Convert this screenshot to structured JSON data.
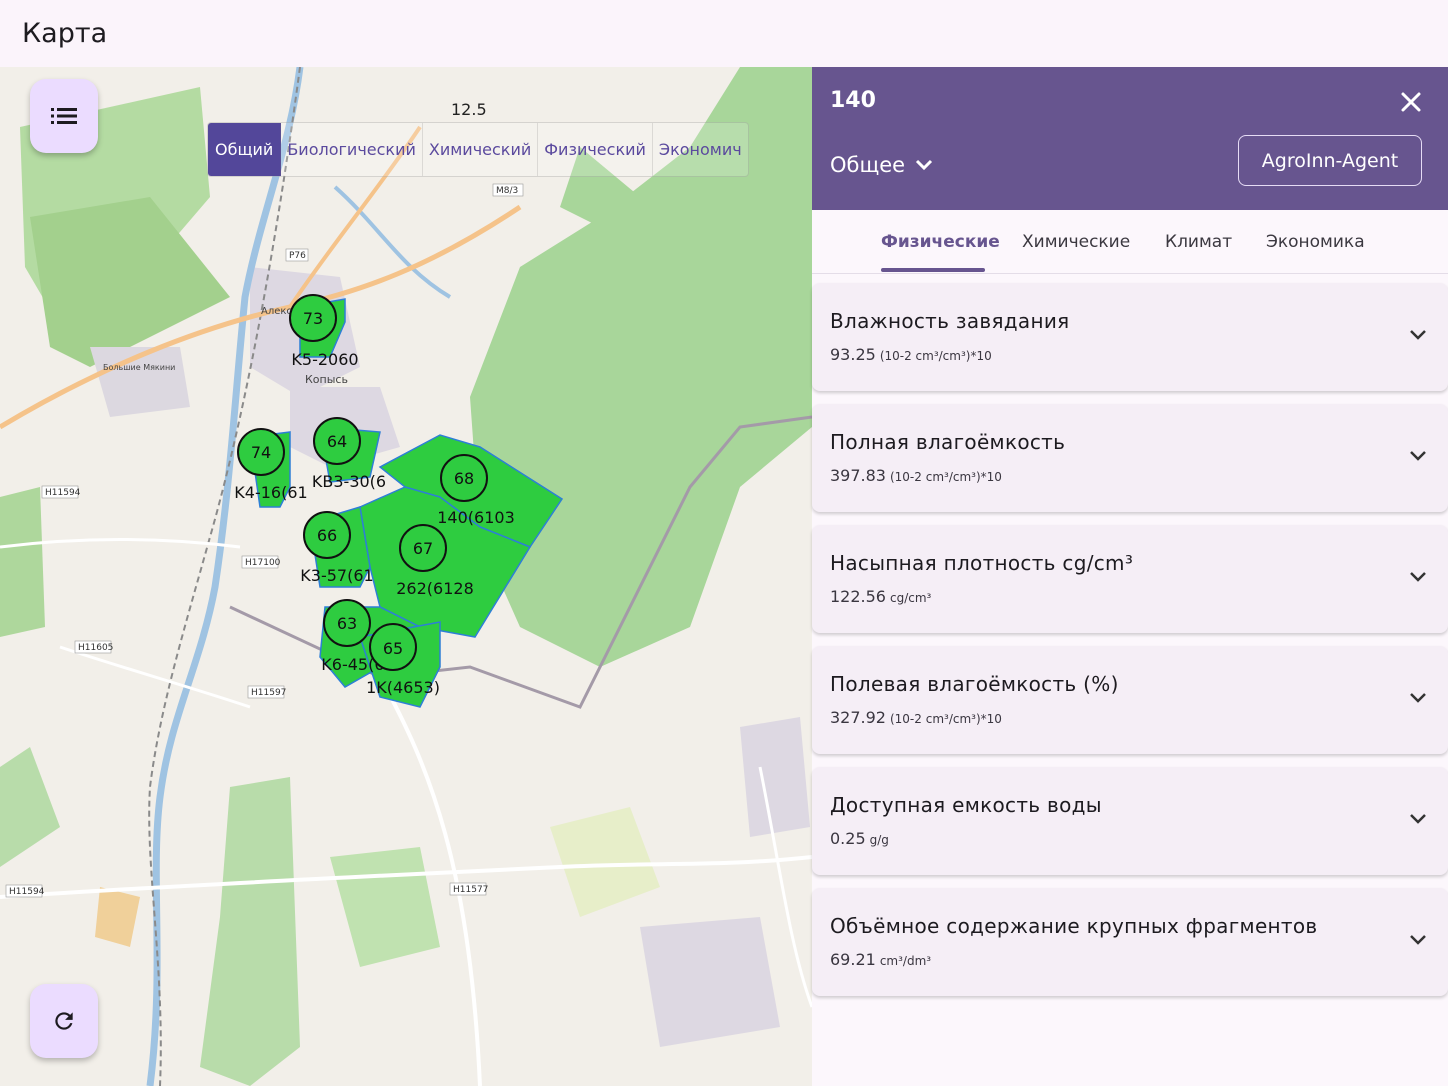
{
  "app": {
    "title": "Карта"
  },
  "map": {
    "layer_tabs": [
      "Общий",
      "Биологический",
      "Химический",
      "Физический",
      "Экономич"
    ],
    "active_layer": "Общий",
    "scale_label": "12.5",
    "places": [
      "Алекс",
      "Копысь",
      "Большие Мякини"
    ],
    "roads": [
      "P76",
      "М8/3",
      "H11594",
      "H17100",
      "H11605",
      "H11597",
      "H11577",
      "H11594"
    ],
    "clusters": [
      {
        "count": "73",
        "label": "K5-2060"
      },
      {
        "count": "74",
        "label": "K4-16(61"
      },
      {
        "count": "64",
        "label": "KB3-30(6"
      },
      {
        "count": "68",
        "label": "140(6103"
      },
      {
        "count": "66",
        "label": "K3-57(61"
      },
      {
        "count": "67",
        "label": "262(6128"
      },
      {
        "count": "63",
        "label": "K6-45(61"
      },
      {
        "count": "65",
        "label": "1K(4653)"
      }
    ],
    "menu_icon": "list-icon",
    "refresh_icon": "refresh-icon"
  },
  "panel": {
    "field_id": "140",
    "close_icon": "close-icon",
    "select_value": "Общее",
    "agent_button": "AgroInn-Agent",
    "tabs": [
      "Физические",
      "Химические",
      "Климат",
      "Экономика"
    ],
    "active_tab": "Физические",
    "cards": [
      {
        "title": "Влажность завядания",
        "value": "93.25",
        "unit": "(10-2 cm³/cm³)*10"
      },
      {
        "title": "Полная влагоёмкость",
        "value": "397.83",
        "unit": "(10-2 cm³/cm³)*10"
      },
      {
        "title": "Насыпная плотность cg/cm³",
        "value": "122.56",
        "unit": "cg/cm³"
      },
      {
        "title": "Полевая влагоёмкость (%)",
        "value": "327.92",
        "unit": "(10-2 cm³/cm³)*10"
      },
      {
        "title": "Доступная емкость воды",
        "value": "0.25",
        "unit": "g/g"
      },
      {
        "title": "Объёмное содержание крупных фрагментов",
        "value": "69.21",
        "unit": "cm³/dm³"
      }
    ]
  },
  "colors": {
    "header": "#67558f",
    "field_fill": "#2ecc40",
    "forest": "#a8d69a",
    "accent_tab": "#53479a"
  }
}
